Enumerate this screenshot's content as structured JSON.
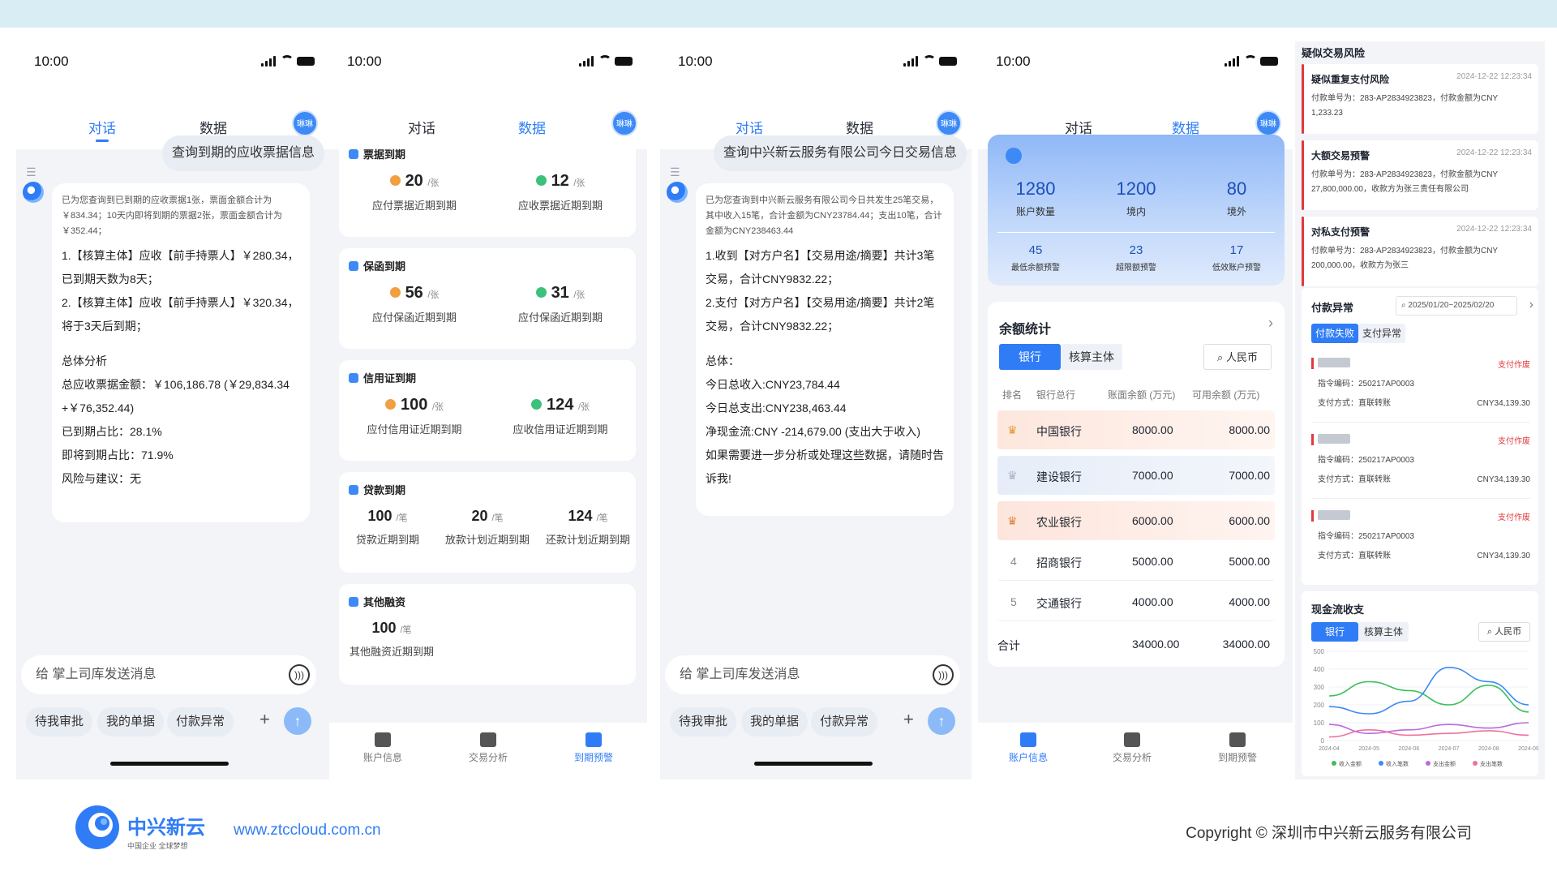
{
  "colors": {
    "primary": "#2f7cf6",
    "accent_red": "#e0393e",
    "bg": "#f2f4f8"
  },
  "phone1": {
    "time": "10:00",
    "tabs": [
      "对话",
      "数据"
    ],
    "avatar": "琳琳",
    "user_message": "查询到期的应收票据信息",
    "reply_intro": "已为您查询到已到期的应收票据1张，票面金额合计为￥834.34；10天内即将到期的票据2张，票面金额合计为￥352.44；",
    "reply_lines": [
      "1.【核算主体】应收【前手持票人】￥280.34，",
      "已到期天数为8天；",
      "2.【核算主体】应收【前手持票人】￥320.34，",
      "将于3天后到期；",
      "",
      "总体分析",
      "总应收票据金额：￥106,186.78 (￥29,834.34",
      "+￥76,352.44)",
      "已到期占比：28.1%",
      "即将到期占比：71.9%",
      "风险与建议：无"
    ],
    "input_placeholder": "给 掌上司库发送消息",
    "chips": [
      "待我审批",
      "我的单据",
      "付款异常"
    ]
  },
  "phone2": {
    "time": "10:00",
    "tabs": [
      "对话",
      "数据"
    ],
    "avatar": "琳琳",
    "sections": [
      {
        "title": "票据到期",
        "items": [
          {
            "num": "20",
            "unit": "/张",
            "label": "应付票据近期到期",
            "dot": "#f0a040"
          },
          {
            "num": "12",
            "unit": "/张",
            "label": "应收票据近期到期",
            "dot": "#3cc17a"
          }
        ]
      },
      {
        "title": "保函到期",
        "items": [
          {
            "num": "56",
            "unit": "/张",
            "label": "应付保函近期到期",
            "dot": "#f0a040"
          },
          {
            "num": "31",
            "unit": "/张",
            "label": "应付保函近期到期",
            "dot": "#3cc17a"
          }
        ]
      },
      {
        "title": "信用证到期",
        "items": [
          {
            "num": "100",
            "unit": "/张",
            "label": "应付信用证近期到期",
            "dot": "#f0a040"
          },
          {
            "num": "124",
            "unit": "/张",
            "label": "应收信用证近期到期",
            "dot": "#3cc17a"
          }
        ]
      },
      {
        "title": "贷款到期",
        "items": [
          {
            "num": "100",
            "unit": "/笔",
            "label": "贷款近期到期"
          },
          {
            "num": "20",
            "unit": "/笔",
            "label": "放款计划近期到期"
          },
          {
            "num": "124",
            "unit": "/笔",
            "label": "还款计划近期到期"
          }
        ]
      },
      {
        "title": "其他融资",
        "items": [
          {
            "num": "100",
            "unit": "/笔",
            "label": "其他融资近期到期"
          }
        ]
      }
    ],
    "bottom_nav": [
      "账户信息",
      "交易分析",
      "到期预警"
    ]
  },
  "phone3": {
    "time": "10:00",
    "tabs": [
      "对话",
      "数据"
    ],
    "avatar": "琳琳",
    "user_message": "查询中兴新云服务有限公司今日交易信息",
    "reply_intro": "已为您查询到中兴新云服务有限公司今日共发生25笔交易，其中收入15笔，合计金额为CNY23784.44；支出10笔，合计金额为CNY238463.44",
    "reply_lines": [
      "1.收到【对方户名】【交易用途/摘要】共计3笔",
      "交易，合计CNY9832.22；",
      "2.支付【对方户名】【交易用途/摘要】共计2笔",
      "交易，合计CNY9832.22；",
      "",
      "总体：",
      "今日总收入:CNY23,784.44",
      "今日总支出:CNY238,463.44",
      "净现金流:CNY -214,679.00 (支出大于收入)",
      "如果需要进一步分析或处理这些数据，请随时告",
      "诉我!"
    ],
    "input_placeholder": "给 掌上司库发送消息",
    "chips": [
      "待我审批",
      "我的单据",
      "付款异常"
    ]
  },
  "phone4": {
    "time": "10:00",
    "tabs": [
      "对话",
      "数据"
    ],
    "avatar": "琳琳",
    "top_stats": [
      {
        "value": "1280",
        "label": "账户数量"
      },
      {
        "value": "1200",
        "label": "境内"
      },
      {
        "value": "80",
        "label": "境外"
      }
    ],
    "warn_stats": [
      {
        "value": "45",
        "label": "最低余额预警"
      },
      {
        "value": "23",
        "label": "超限额预警"
      },
      {
        "value": "17",
        "label": "低效账户预警"
      }
    ],
    "balance_title": "余额统计",
    "seg": [
      "银行",
      "核算主体"
    ],
    "currency": "人民币",
    "table_headers": [
      "排名",
      "银行总行",
      "账面余额 (万元)",
      "可用余额 (万元)"
    ],
    "rows": [
      {
        "rank": "1",
        "bank": "中国银行",
        "book": "8000.00",
        "avail": "8000.00"
      },
      {
        "rank": "2",
        "bank": "建设银行",
        "book": "7000.00",
        "avail": "7000.00"
      },
      {
        "rank": "3",
        "bank": "农业银行",
        "book": "6000.00",
        "avail": "6000.00"
      },
      {
        "rank": "4",
        "bank": "招商银行",
        "book": "5000.00",
        "avail": "5000.00"
      },
      {
        "rank": "5",
        "bank": "交通银行",
        "book": "4000.00",
        "avail": "4000.00"
      }
    ],
    "total": {
      "label": "合计",
      "book": "34000.00",
      "avail": "34000.00"
    },
    "bottom_nav": [
      "账户信息",
      "交易分析",
      "到期预警"
    ]
  },
  "right_panel": {
    "risk_title": "疑似交易风险",
    "risks": [
      {
        "title": "疑似重复支付风险",
        "time": "2024-12-22 12:23:34",
        "line1": "付款单号为：283-AP2834923823，付款金额为CNY",
        "line2": "1,233.23"
      },
      {
        "title": "大额交易预警",
        "time": "2024-12-22 12:23:34",
        "line1": "付款单号为：283-AP2834923823，付款金额为CNY",
        "line2": "27,800,000.00，收款方为张三责任有限公司"
      },
      {
        "title": "对私支付预警",
        "time": "2024-12-22 12:23:34",
        "line1": "付款单号为：283-AP2834923823，付款金额为CNY",
        "line2": "200,000.00，收款方为张三"
      }
    ],
    "payfail_title": "付款异常",
    "date_range": "2025/01/20~2025/02/20",
    "pay_tabs": [
      "付款失败",
      "支付异常"
    ],
    "payments": [
      {
        "status": "支付作废",
        "code_label": "指令编码：",
        "code": "250217AP0003",
        "method_label": "支付方式：",
        "method": "直联转账",
        "amount": "CNY34,139.30"
      },
      {
        "status": "支付作废",
        "code_label": "指令编码：",
        "code": "250217AP0003",
        "method_label": "支付方式：",
        "method": "直联转账",
        "amount": "CNY34,139.30"
      },
      {
        "status": "支付作废",
        "code_label": "指令编码：",
        "code": "250217AP0003",
        "method_label": "支付方式：",
        "method": "直联转账",
        "amount": "CNY34,139.30"
      }
    ],
    "cashflow_title": "现金流收支",
    "cf_tabs": [
      "银行",
      "核算主体"
    ],
    "currency": "人民币"
  },
  "chart_data": {
    "type": "line",
    "title": "现金流收支",
    "categories": [
      "2024-04",
      "2024-05",
      "2024-06",
      "2024-07",
      "2024-08",
      "2024-09"
    ],
    "ylim": [
      0,
      500
    ],
    "yticks": [
      "500",
      "400",
      "300",
      "200",
      "100",
      "0"
    ],
    "series": [
      {
        "name": "收入金额",
        "color": "#3cbf5a",
        "values": [
          250,
          330,
          280,
          200,
          310,
          160
        ]
      },
      {
        "name": "收入笔数",
        "color": "#3d8af7",
        "values": [
          190,
          150,
          220,
          410,
          330,
          200
        ]
      },
      {
        "name": "支出金额",
        "color": "#b96be0",
        "values": [
          90,
          40,
          60,
          90,
          70,
          100
        ]
      },
      {
        "name": "支出笔数",
        "color": "#f06fa0",
        "values": [
          20,
          60,
          30,
          40,
          55,
          30
        ]
      }
    ]
  },
  "footer": {
    "brand": "中兴新云",
    "slogan": "中国企业 全球梦想",
    "url": "www.ztccloud.com.cn",
    "copyright": "Copyright © 深圳市中兴新云服务有限公司"
  }
}
